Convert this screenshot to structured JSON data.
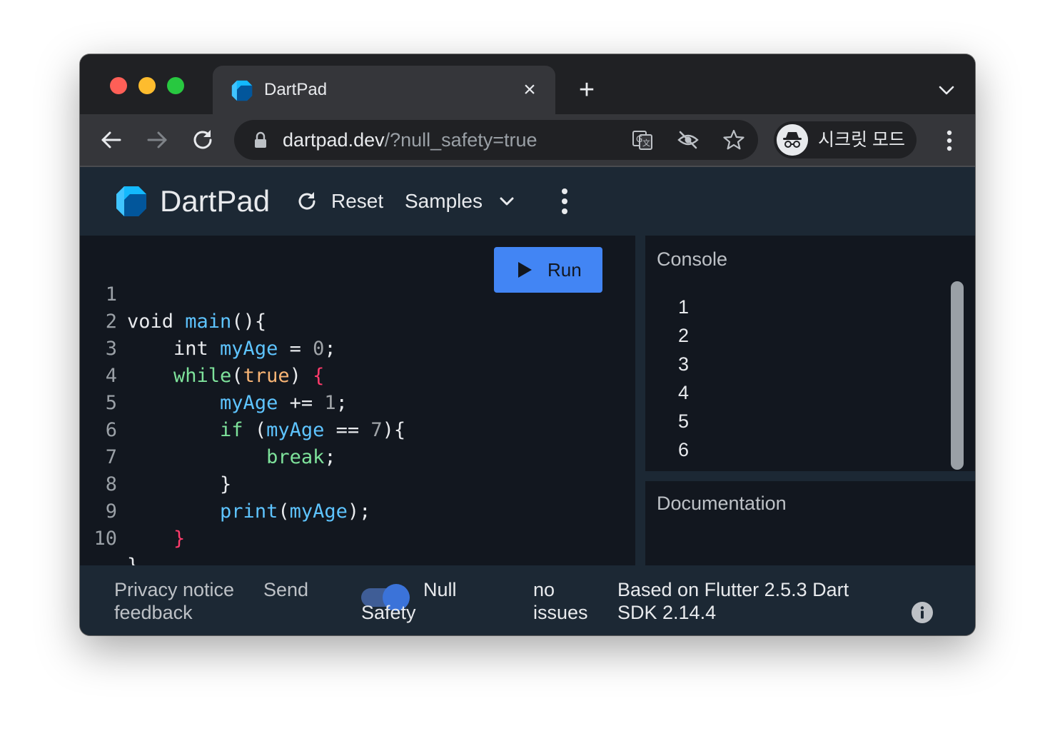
{
  "browser": {
    "tab": {
      "title": "DartPad"
    },
    "url": {
      "host": "dartpad.dev",
      "path": "/?null_safety=true"
    },
    "incognito_label": "시크릿 모드",
    "icons": [
      "back-arrow-icon",
      "forward-arrow-icon",
      "reload-icon",
      "lock-icon",
      "translate-icon",
      "eye-off-icon",
      "star-icon",
      "incognito-icon",
      "kebab-menu-icon"
    ]
  },
  "header": {
    "title": "DartPad",
    "reset_label": "Reset",
    "samples_label": "Samples"
  },
  "editor": {
    "run_label": "Run",
    "line_numbers": [
      "1",
      "2",
      "3",
      "4",
      "5",
      "6",
      "7",
      "8",
      "9",
      "10"
    ]
  },
  "console": {
    "title": "Console",
    "output": [
      "1",
      "2",
      "3",
      "4",
      "5",
      "6"
    ]
  },
  "docs": {
    "title": "Documentation"
  },
  "footer": {
    "privacy": "Privacy notice",
    "send": "Send",
    "feedback": "feedback",
    "null": "Null",
    "safety": "Safety",
    "no": "no",
    "issues": "issues",
    "based_line1": "Based on Flutter 2.5.3 Dart",
    "based_line2": "SDK 2.14.4"
  },
  "colors": {
    "run_button": "#4285f4",
    "editor_bg": "#12171f",
    "header_bg": "#1c2834",
    "function_color": "#5ec4ff",
    "keyword_color": "#7ee29b"
  }
}
